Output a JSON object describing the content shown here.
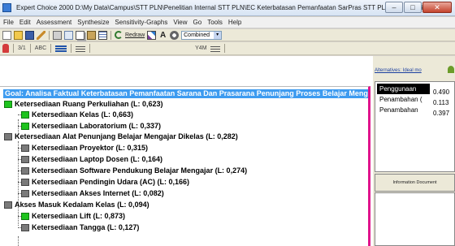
{
  "window": {
    "title": "Expert Choice 2000   D:\\My Data\\Campus\\STT PLN\\Penelitian Internal STT PLN\\EC Keterbatasan Pemanfaatan SarPras STT PLN.ahp   Combined",
    "minimize_glyph": "–",
    "maximize_glyph": "□",
    "close_glyph": "✕"
  },
  "menu": {
    "items": [
      "File",
      "Edit",
      "Assessment",
      "Synthesize",
      "Sensitivity-Graphs",
      "View",
      "Go",
      "Tools",
      "Help"
    ]
  },
  "toolbar": {
    "redraw_label": "Redraw",
    "combined_value": "Combined",
    "combined_arrow": "▾",
    "font_glyph": "A"
  },
  "toolbar2": {
    "items": [
      "3/1",
      "ABC",
      "Y4M"
    ]
  },
  "alternatives_panel": {
    "header": "Alternatives: Ideal mo",
    "rows": [
      {
        "name": "Penggunaan",
        "value": "0,490",
        "selected": true
      },
      {
        "name": "Penambahan (",
        "value": "0,113",
        "selected": false
      },
      {
        "name": "Penambahan",
        "value": "0,397",
        "selected": false
      }
    ],
    "info_header": "Information Document"
  },
  "tree": {
    "goal": "Goal: Analisa Faktual Keterbatasan Pemanfaatan Sarana Dan Prasarana Penunjang Proses Belajar Mengajar",
    "nodes": [
      {
        "label": "Ketersediaan Ruang Perkuliahan (L: 0,623)",
        "level": 0,
        "color": "green"
      },
      {
        "label": "Ketersediaan Kelas (L: 0,663)",
        "level": 1,
        "color": "green"
      },
      {
        "label": "Ketersediaan Laboratorium (L: 0,337)",
        "level": 1,
        "color": "green"
      },
      {
        "label": "Ketersediaan Alat Penunjang Belajar Mengajar Dikelas (L: 0,282)",
        "level": 0,
        "color": "gray"
      },
      {
        "label": "Ketersediaan Proyektor (L: 0,315)",
        "level": 1,
        "color": "gray"
      },
      {
        "label": "Ketersediaan Laptop Dosen (L: 0,164)",
        "level": 1,
        "color": "gray"
      },
      {
        "label": "Ketersediaan Software Pendukung Belajar Mengajar (L: 0,274)",
        "level": 1,
        "color": "gray"
      },
      {
        "label": "Ketersediaan Pendingin Udara (AC) (L: 0,166)",
        "level": 1,
        "color": "gray"
      },
      {
        "label": "Ketersediaan Akses Internet (L: 0,082)",
        "level": 1,
        "color": "gray"
      },
      {
        "label": "Akses Masuk Kedalam Kelas (L: 0,094)",
        "level": 0,
        "color": "gray"
      },
      {
        "label": "Ketersediaan Lift (L: 0,873)",
        "level": 1,
        "color": "green"
      },
      {
        "label": "Ketersediaan Tangga (L: 0,127)",
        "level": 1,
        "color": "gray"
      }
    ]
  }
}
